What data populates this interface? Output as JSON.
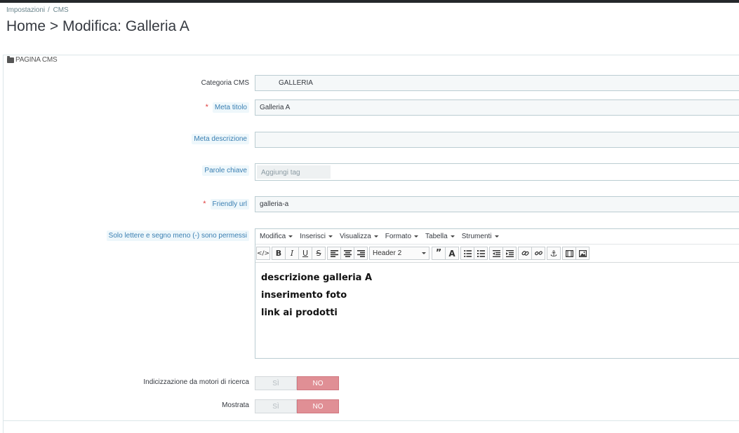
{
  "breadcrumb": {
    "items": [
      "Impostazioni",
      "CMS"
    ],
    "separator": "/"
  },
  "page_title": "Home > Modifica: Galleria A",
  "panel": {
    "heading": "PAGINA CMS"
  },
  "form": {
    "categoria": {
      "label": "Categoria CMS",
      "value": "GALLERIA"
    },
    "meta_titolo": {
      "required": "*",
      "label": "Meta titolo",
      "value": "Galleria A"
    },
    "meta_descrizione": {
      "label": "Meta descrizione",
      "value": ""
    },
    "parole_chiave": {
      "label": "Parole chiave",
      "placeholder": "Aggiungi tag"
    },
    "friendly_url": {
      "required": "*",
      "label": "Friendly url",
      "value": "galleria-a"
    },
    "contenuto": {
      "label": "Solo lettere e segno meno (-) sono permessi"
    },
    "indicizzazione": {
      "label": "Indicizzazione da motori di ricerca",
      "yes": "SÌ",
      "no": "NO",
      "selected": "NO"
    },
    "mostrata": {
      "label": "Mostrata",
      "yes": "SÌ",
      "no": "NO",
      "selected": "NO"
    }
  },
  "editor": {
    "menu": [
      "Modifica",
      "Inserisci",
      "Visualizza",
      "Formato",
      "Tabella",
      "Strumenti"
    ],
    "format_select": "Header 2",
    "paragraphs": [
      "descrizione galleria A",
      "inserimento foto",
      "link ai prodotti"
    ]
  },
  "colors": {
    "accent": "#25b9d7",
    "required": "#e03d3d",
    "switch_no": "#e08f95"
  }
}
